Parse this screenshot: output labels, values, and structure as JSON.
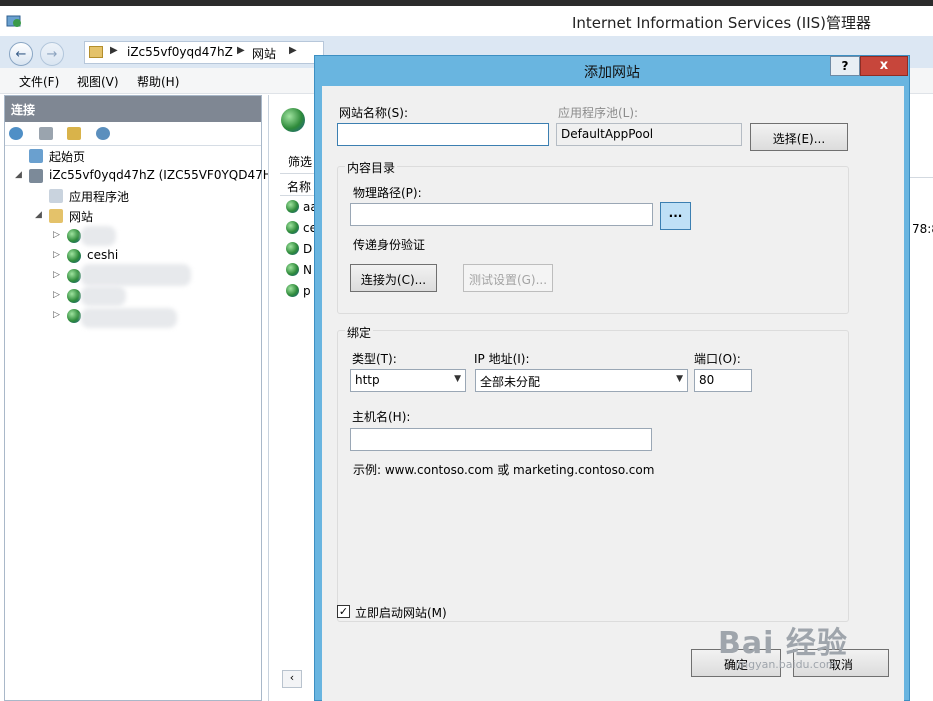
{
  "window": {
    "title": "Internet Information Services (IIS)管理器"
  },
  "address": {
    "crumbs": [
      "iZc55vf0yqd47hZ",
      "网站"
    ]
  },
  "menu": {
    "items": [
      "文件(F)",
      "视图(V)",
      "帮助(H)"
    ]
  },
  "connections": {
    "header": "连接",
    "tree": {
      "start_page": "起始页",
      "server": "iZc55vf0yqd47hZ (IZC55VF0YQD47HZ",
      "app_pools": "应用程序池",
      "sites": "网站",
      "site_visible": "ceshi"
    }
  },
  "middle": {
    "filter_label": "筛选",
    "column_name": "名称",
    "items": [
      "aa",
      "ce",
      "D",
      "N",
      "p"
    ],
    "right_clip_text": "78:8"
  },
  "dialog": {
    "title": "添加网站",
    "help_label": "?",
    "close_label": "x",
    "site_name_label": "网站名称(S):",
    "site_name_value": "",
    "app_pool_label": "应用程序池(L):",
    "app_pool_value": "DefaultAppPool",
    "select_button": "选择(E)...",
    "content_dir_label": "内容目录",
    "physical_path_label": "物理路径(P):",
    "physical_path_value": "",
    "browse_button": "...",
    "pass_auth_label": "传递身份验证",
    "connect_as_button": "连接为(C)...",
    "test_settings_button": "测试设置(G)...",
    "binding_label": "绑定",
    "type_label": "类型(T):",
    "type_value": "http",
    "ip_label": "IP 地址(I):",
    "ip_value": "全部未分配",
    "port_label": "端口(O):",
    "port_value": "80",
    "hostname_label": "主机名(H):",
    "hostname_value": "",
    "example_text": "示例: www.contoso.com 或 marketing.contoso.com",
    "start_immediately_label": "立即启动网站(M)",
    "start_immediately_checked": true,
    "ok_button": "确定",
    "cancel_button": "取消"
  },
  "watermark": {
    "text": "Bai 经验",
    "sub": "jingyan.baidu.com"
  }
}
